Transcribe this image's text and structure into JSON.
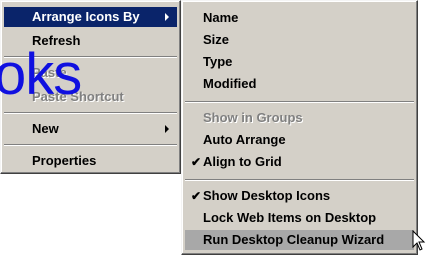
{
  "context_menu": {
    "items": [
      {
        "label": "Arrange Icons By",
        "submenu": true,
        "highlighted": true
      },
      {
        "label": "Refresh"
      },
      {
        "label": "Paste",
        "disabled": true
      },
      {
        "label": "Paste Shortcut",
        "disabled": true
      },
      {
        "label": "New",
        "submenu": true
      },
      {
        "label": "Properties"
      }
    ]
  },
  "arrange_submenu": {
    "group1": [
      "Name",
      "Size",
      "Type",
      "Modified"
    ],
    "show_in_groups": "Show in Groups",
    "auto_arrange": "Auto Arrange",
    "align_to_grid": "Align to Grid",
    "show_desktop_icons": "Show Desktop Icons",
    "lock_web_items": "Lock Web Items on Desktop",
    "cleanup_wizard": "Run Desktop Cleanup Wizard"
  },
  "check_glyph": "✔",
  "watermark_text": "oks",
  "colors": {
    "menu_bg": "#d4d0c8",
    "highlight": "#0a246a",
    "selected_gray": "#a8a8a8",
    "watermark": "#1010e0"
  }
}
